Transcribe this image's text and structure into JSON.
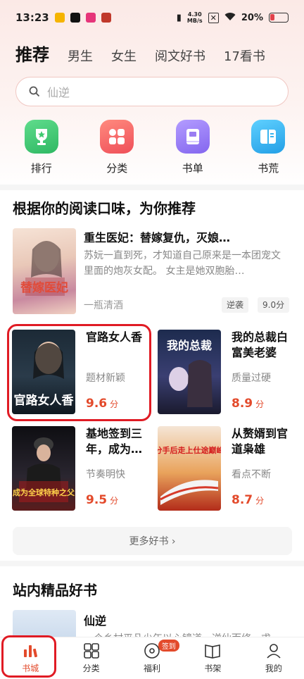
{
  "status": {
    "time": "13:23",
    "net_speed_value": "4.30",
    "net_speed_unit": "MB/s",
    "battery": "20%"
  },
  "tabs": [
    {
      "label": "推荐",
      "active": true
    },
    {
      "label": "男生"
    },
    {
      "label": "女生"
    },
    {
      "label": "阅文好书"
    },
    {
      "label": "17看书"
    }
  ],
  "search": {
    "placeholder": "仙逆"
  },
  "quick": [
    {
      "label": "排行",
      "icon": "ranking-trophy-icon",
      "color": "#3ec96e"
    },
    {
      "label": "分类",
      "icon": "category-grid-icon",
      "color": "#f2656a"
    },
    {
      "label": "书单",
      "icon": "booklist-icon",
      "color": "#9a7df2"
    },
    {
      "label": "书荒",
      "icon": "book-open-icon",
      "color": "#38b4ef"
    }
  ],
  "recommend": {
    "title": "根据你的阅读口味，为你推荐",
    "featured": {
      "title": "重生医妃：替嫁复仇，灭娘…",
      "desc": "苏妧一直到死，才知道自己原来是一本团宠文里面的炮灰女配。   女主是她双胞胎…",
      "author": "一瓶清酒",
      "tag": "逆袭",
      "score": "9.0分",
      "cover_text": "替嫁医妃"
    },
    "books": [
      {
        "title": "官路女人香",
        "sub": "题材新颖",
        "score": "9.6",
        "unit": "分",
        "cover_text": "官路女人香"
      },
      {
        "title": "我的总裁白富美老婆",
        "sub": "质量过硬",
        "score": "8.9",
        "unit": "分",
        "cover_text": "我的总裁"
      },
      {
        "title": "基地签到三年，成为…",
        "sub": "节奏明快",
        "score": "9.5",
        "unit": "分",
        "cover_text": "成为全球特种之父"
      },
      {
        "title": "从赘婿到官道枭雄",
        "sub": "看点不断",
        "score": "8.7",
        "unit": "分",
        "cover_text": "分手后走上仕途巅峰"
      }
    ],
    "more_label": "更多好书 ›"
  },
  "premium": {
    "title": "站内精品好书",
    "first_title": "仙逆",
    "first_desc": "一个乡村平凡少年以心镜道，逆仙而修，求…"
  },
  "nav": [
    {
      "label": "书城",
      "active": true
    },
    {
      "label": "分类"
    },
    {
      "label": "福利",
      "badge": "签到"
    },
    {
      "label": "书架"
    },
    {
      "label": "我的"
    }
  ]
}
